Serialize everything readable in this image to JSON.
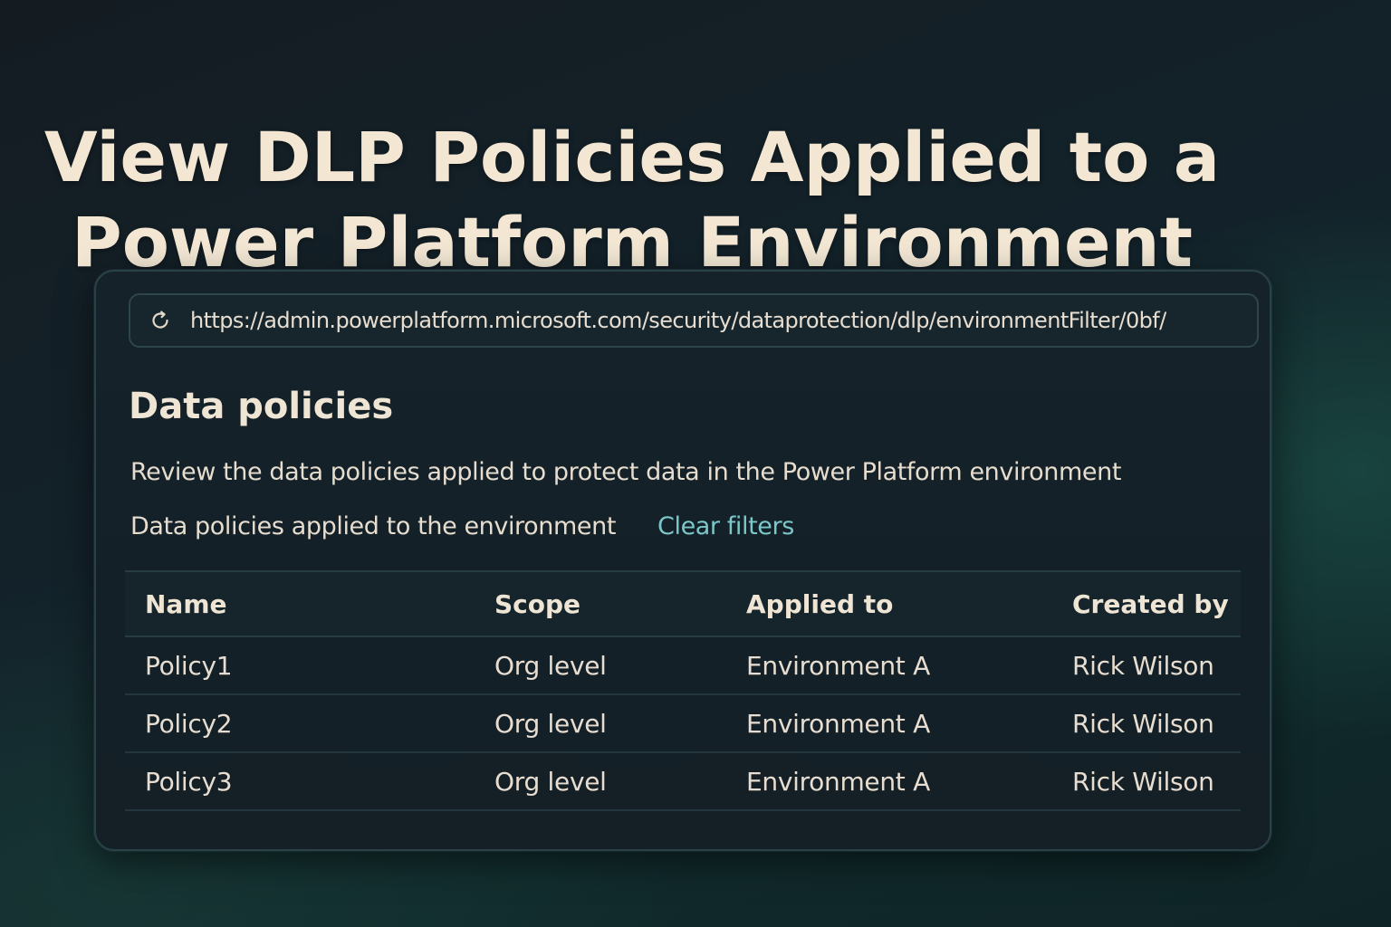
{
  "page": {
    "title_line1": "View DLP Policies Applied to a",
    "title_line2": "Power Platform Environment"
  },
  "browser": {
    "url": "https://admin.powerplatform.microsoft.com/security/dataprotection/dlp/environmentFilter/0bf/",
    "reload_icon": "reload-icon"
  },
  "main": {
    "heading": "Data policies",
    "description": "Review the data policies applied to protect data in the Power Platform environment",
    "filter_label": "Data policies applied to the environment",
    "clear_filters_label": "Clear filters"
  },
  "table": {
    "columns": [
      "Name",
      "Scope",
      "Applied to",
      "Created by"
    ],
    "rows": [
      {
        "name": "Policy1",
        "scope": "Org level",
        "applied_to": "Environment A",
        "created_by": "Rick Wilson"
      },
      {
        "name": "Policy2",
        "scope": "Org level",
        "applied_to": "Environment A",
        "created_by": "Rick Wilson"
      },
      {
        "name": "Policy3",
        "scope": "Org level",
        "applied_to": "Environment A",
        "created_by": "Rick Wilson"
      }
    ]
  },
  "colors": {
    "accent_link": "#7cc7c9",
    "title_text": "#f3e7d4"
  }
}
